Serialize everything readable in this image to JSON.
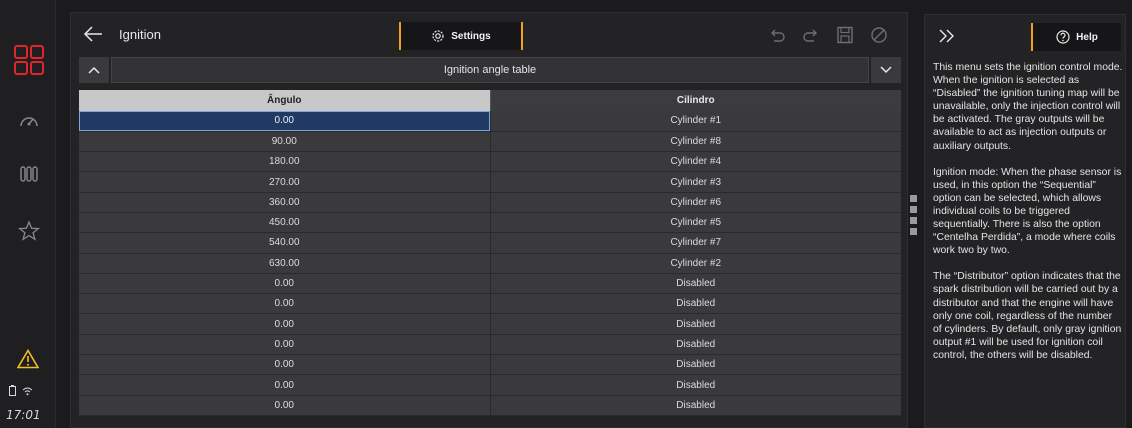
{
  "rail": {
    "icons": [
      "logo-icon",
      "speedometer-icon",
      "gauges-icon",
      "favorites-icon",
      "warning-icon"
    ],
    "time": "17:01"
  },
  "header": {
    "title": "Ignition",
    "settings_label": "Settings"
  },
  "table_bar": {
    "title": "Ignition angle table"
  },
  "table": {
    "columns": [
      "Ângulo",
      "Cilindro"
    ],
    "rows": [
      [
        "0.00",
        "Cylinder #1"
      ],
      [
        "90.00",
        "Cylinder #8"
      ],
      [
        "180.00",
        "Cylinder #4"
      ],
      [
        "270.00",
        "Cylinder #3"
      ],
      [
        "360.00",
        "Cylinder #6"
      ],
      [
        "450.00",
        "Cylinder #5"
      ],
      [
        "540.00",
        "Cylinder #7"
      ],
      [
        "630.00",
        "Cylinder #2"
      ],
      [
        "0.00",
        "Disabled"
      ],
      [
        "0.00",
        "Disabled"
      ],
      [
        "0.00",
        "Disabled"
      ],
      [
        "0.00",
        "Disabled"
      ],
      [
        "0.00",
        "Disabled"
      ],
      [
        "0.00",
        "Disabled"
      ],
      [
        "0.00",
        "Disabled"
      ]
    ]
  },
  "help": {
    "label": "Help",
    "paragraphs": [
      "This menu sets the ignition control mode. When the ignition is selected as “Disabled” the ignition tuning map will be unavailable, only the injection control will be activated. The gray outputs will be available to act as injection outputs or auxiliary outputs.",
      "Ignition mode: When the phase sensor is used, in this option the “Sequential” option can be selected, which allows individual coils to be triggered sequentially. There is also the option “Centelha Perdida”, a mode where coils work two by two.",
      "The “Distributor” option indicates that the spark distribution will be carried out by a distributor and that the engine will have only one coil, regardless of the number of cylinders. By default, only gray ignition output #1 will be used for ignition coil control, the others will be disabled."
    ]
  },
  "colors": {
    "accent": "#f0a020",
    "logo": "#e0262b",
    "warning": "#f0c020",
    "selected_cell": "#213a63"
  }
}
